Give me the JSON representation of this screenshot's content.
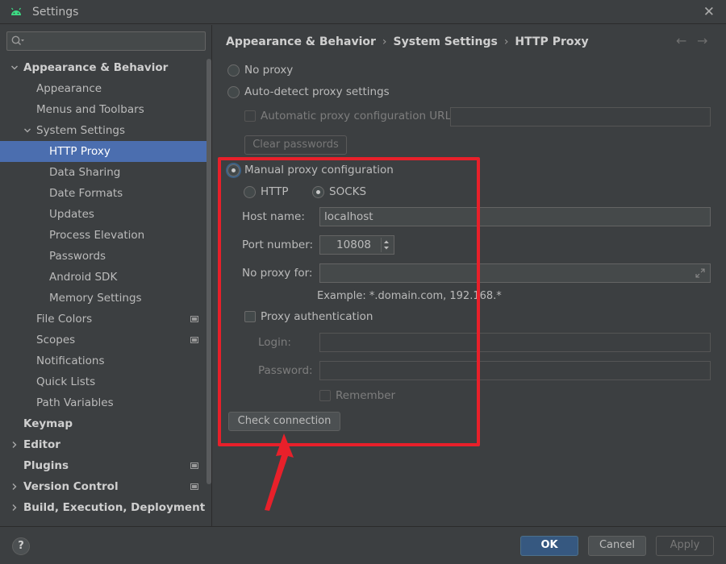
{
  "window": {
    "title": "Settings",
    "app_icon": "android-icon",
    "close_glyph": "✕"
  },
  "sidebar": {
    "search": {
      "value": "",
      "placeholder": ""
    },
    "items": [
      {
        "label": "Appearance & Behavior",
        "level": 0,
        "bold": true,
        "arrow": "down"
      },
      {
        "label": "Appearance",
        "level": 1
      },
      {
        "label": "Menus and Toolbars",
        "level": 1
      },
      {
        "label": "System Settings",
        "level": 1,
        "arrow": "down"
      },
      {
        "label": "HTTP Proxy",
        "level": 2,
        "selected": true
      },
      {
        "label": "Data Sharing",
        "level": 2
      },
      {
        "label": "Date Formats",
        "level": 2
      },
      {
        "label": "Updates",
        "level": 2
      },
      {
        "label": "Process Elevation",
        "level": 2
      },
      {
        "label": "Passwords",
        "level": 2
      },
      {
        "label": "Android SDK",
        "level": 2
      },
      {
        "label": "Memory Settings",
        "level": 2
      },
      {
        "label": "File Colors",
        "level": 1,
        "badge": true
      },
      {
        "label": "Scopes",
        "level": 1,
        "badge": true
      },
      {
        "label": "Notifications",
        "level": 1
      },
      {
        "label": "Quick Lists",
        "level": 1
      },
      {
        "label": "Path Variables",
        "level": 1
      },
      {
        "label": "Keymap",
        "level": 0,
        "bold": true
      },
      {
        "label": "Editor",
        "level": 0,
        "bold": true,
        "arrow": "right"
      },
      {
        "label": "Plugins",
        "level": 0,
        "bold": true,
        "badge": true
      },
      {
        "label": "Version Control",
        "level": 0,
        "bold": true,
        "arrow": "right",
        "badge": true
      },
      {
        "label": "Build, Execution, Deployment",
        "level": 0,
        "bold": true,
        "arrow": "right"
      }
    ]
  },
  "breadcrumb": {
    "parts": [
      "Appearance & Behavior",
      "System Settings",
      "HTTP Proxy"
    ],
    "separator": "›",
    "back": "←",
    "forward": "→"
  },
  "proxy": {
    "no_proxy": "No proxy",
    "auto_detect": "Auto-detect proxy settings",
    "auto_url_label": "Automatic proxy configuration URL:",
    "auto_url_value": "",
    "clear_passwords": "Clear passwords",
    "manual": "Manual proxy configuration",
    "selected_mode": "manual",
    "http": "HTTP",
    "socks": "SOCKS",
    "selected_protocol": "socks",
    "host_label": "Host name:",
    "host_value": "localhost",
    "port_label": "Port number:",
    "port_value": "10808",
    "no_proxy_for_label": "No proxy for:",
    "no_proxy_for_value": "",
    "example": "Example: *.domain.com, 192.168.*",
    "proxy_auth": "Proxy authentication",
    "login_label": "Login:",
    "login_value": "",
    "password_label": "Password:",
    "password_value": "",
    "remember": "Remember",
    "check_connection": "Check connection"
  },
  "footer": {
    "help": "?",
    "ok": "OK",
    "cancel": "Cancel",
    "apply": "Apply"
  },
  "colors": {
    "background": "#3c3f41",
    "selection": "#4b6eaf",
    "annotation_red": "#e8202a",
    "primary_button": "#365880"
  }
}
